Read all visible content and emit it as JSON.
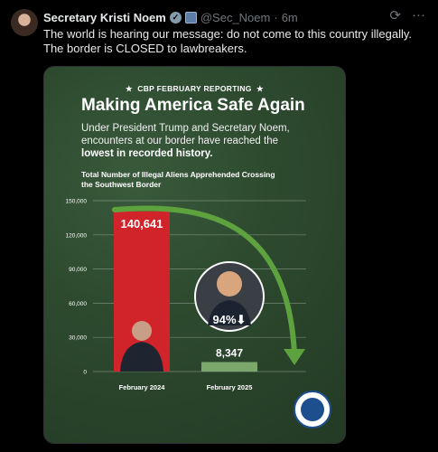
{
  "author": {
    "name": "Secretary Kristi Noem",
    "handle": "@Sec_Noem",
    "time": "6m"
  },
  "tweet": {
    "text": "The world is hearing our message: do not come to this country illegally. The border is CLOSED to lawbreakers."
  },
  "actions": {
    "grok_icon": "grok-icon",
    "more_icon": "more-icon"
  },
  "card": {
    "kicker": "CBP FEBRUARY REPORTING",
    "title": "Making America Safe Again",
    "subtitle_plain": "Under President Trump and Secretary Noem, encounters at our border have reached the",
    "subtitle_bold": "lowest in recorded history.",
    "chart_title": "Total Number of Illegal Aliens Apprehended Crossing the Southwest Border",
    "badge": "94%⬇",
    "colors": {
      "bar1": "#d1232a",
      "bar2": "#7ba86a",
      "arrow": "#5ea23f",
      "bg": "#2d4a2f"
    }
  },
  "chart_data": {
    "type": "bar",
    "title": "Total Number of Illegal Aliens Apprehended Crossing the Southwest Border",
    "categories": [
      "February 2024",
      "February 2025"
    ],
    "values": [
      140641,
      8347
    ],
    "value_labels": [
      "140,641",
      "8,347"
    ],
    "ylim": [
      0,
      150000
    ],
    "yticks": [
      0,
      30000,
      60000,
      90000,
      120000,
      150000
    ],
    "ytick_labels": [
      "0",
      "30,000",
      "60,000",
      "90,000",
      "120,000",
      "150,000"
    ],
    "grid": true,
    "annotation": "94%⬇"
  }
}
